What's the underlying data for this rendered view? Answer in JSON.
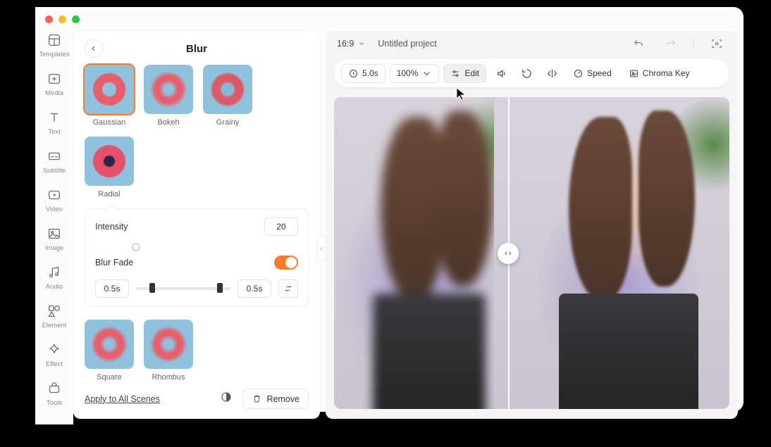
{
  "sidebar": {
    "items": [
      {
        "label": "Templates"
      },
      {
        "label": "Media"
      },
      {
        "label": "Text"
      },
      {
        "label": "Subtitle"
      },
      {
        "label": "Video"
      },
      {
        "label": "Image"
      },
      {
        "label": "Audio"
      },
      {
        "label": "Element"
      },
      {
        "label": "Effect"
      },
      {
        "label": "Tools"
      }
    ]
  },
  "panel": {
    "title": "Blur",
    "options_row1": [
      {
        "label": "Gaussian",
        "selected": true
      },
      {
        "label": "Bokeh"
      },
      {
        "label": "Grainy"
      },
      {
        "label": "Radial"
      }
    ],
    "options_row2": [
      {
        "label": "Square"
      },
      {
        "label": "Rhombus"
      }
    ],
    "intensity": {
      "label": "Intensity",
      "value": "20",
      "percent": 20
    },
    "blur_fade": {
      "label": "Blur Fade",
      "enabled": true,
      "in": "0.5s",
      "out": "0.5s"
    },
    "apply_all": "Apply to All Scenes",
    "remove": "Remove"
  },
  "canvas": {
    "aspect": "16:9",
    "project": "Untitled project",
    "toolbar": {
      "duration": "5.0s",
      "zoom": "100%",
      "edit": "Edit",
      "speed": "Speed",
      "chroma": "Chroma Key"
    }
  },
  "colors": {
    "accent": "#ff7a2d"
  }
}
